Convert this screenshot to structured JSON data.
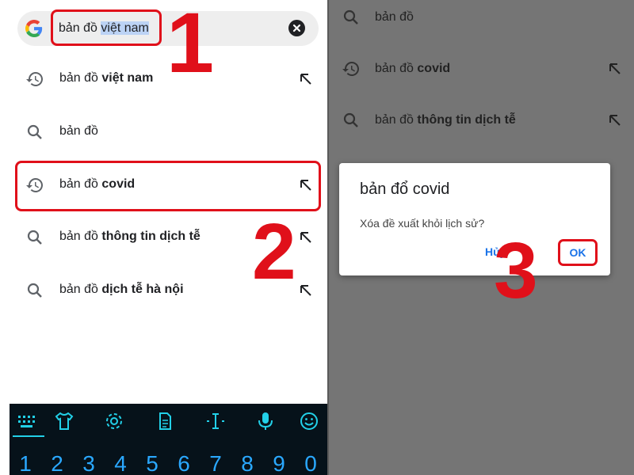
{
  "left": {
    "search": {
      "query_prefix": "bản đồ ",
      "query_selected": "việt nam"
    },
    "suggestions": [
      {
        "type": "history",
        "normal": "bản đồ ",
        "bold": "việt nam"
      },
      {
        "type": "search",
        "normal": "bản đồ",
        "bold": ""
      },
      {
        "type": "history",
        "normal": "bản đồ ",
        "bold": "covid"
      },
      {
        "type": "search",
        "normal": "bản đồ ",
        "bold": "thông tin dịch tễ"
      },
      {
        "type": "search",
        "normal": "bản đồ ",
        "bold": "dịch tễ hà nội"
      }
    ],
    "keyboard": {
      "digits": [
        "1",
        "2",
        "3",
        "4",
        "5",
        "6",
        "7",
        "8",
        "9",
        "0"
      ],
      "tools": [
        "keyboard-hide-icon",
        "shirt-icon",
        "gear-icon",
        "clipboard-icon",
        "text-cursor-icon",
        "microphone-icon",
        "emoji-icon"
      ]
    }
  },
  "right": {
    "suggestions": [
      {
        "type": "search",
        "normal": "bản đồ",
        "bold": ""
      },
      {
        "type": "history",
        "normal": "bản đồ ",
        "bold": "covid"
      },
      {
        "type": "search",
        "normal": "bản đồ ",
        "bold": "thông tin dịch tễ"
      }
    ],
    "dialog": {
      "title": "bản đổ covid",
      "message": "Xóa đề xuất khỏi lịch sử?",
      "cancel_label": "Hủy",
      "ok_label": "OK"
    }
  },
  "annotations": {
    "step1": "1",
    "step2": "2",
    "step3": "3"
  },
  "colors": {
    "highlight": "#e0101a",
    "link": "#1a73e8",
    "keyboard_bg": "#06121a",
    "keyboard_digit": "#2aa8ff"
  }
}
